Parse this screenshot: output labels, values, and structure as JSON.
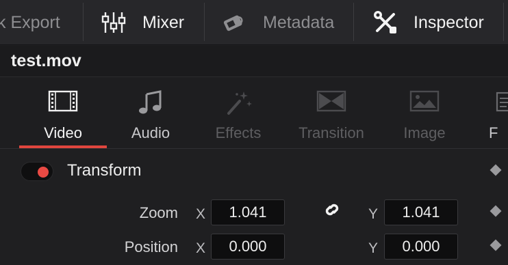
{
  "toolbar": {
    "quick_export_label": "k Export",
    "mixer_label": "Mixer",
    "metadata_label": "Metadata",
    "inspector_label": "Inspector"
  },
  "clip": {
    "title": "test.mov"
  },
  "tabs": [
    {
      "label": "Video",
      "state": "active",
      "icon": "film-icon"
    },
    {
      "label": "Audio",
      "state": "normal",
      "icon": "music-note-icon"
    },
    {
      "label": "Effects",
      "state": "disabled",
      "icon": "magic-wand-icon"
    },
    {
      "label": "Transition",
      "state": "disabled",
      "icon": "transition-icon"
    },
    {
      "label": "Image",
      "state": "disabled",
      "icon": "image-icon"
    },
    {
      "label": "F",
      "state": "normal",
      "icon": "file-icon"
    }
  ],
  "transform": {
    "title": "Transform",
    "enabled": true,
    "zoom": {
      "label": "Zoom",
      "x_axis": "X",
      "x": "1.041",
      "y_axis": "Y",
      "y": "1.041",
      "linked": true
    },
    "position": {
      "label": "Position",
      "x_axis": "X",
      "x": "0.000",
      "y_axis": "Y",
      "y": "0.000"
    }
  },
  "colors": {
    "accent": "#e0463e",
    "toggle_on": "#e94a44"
  }
}
